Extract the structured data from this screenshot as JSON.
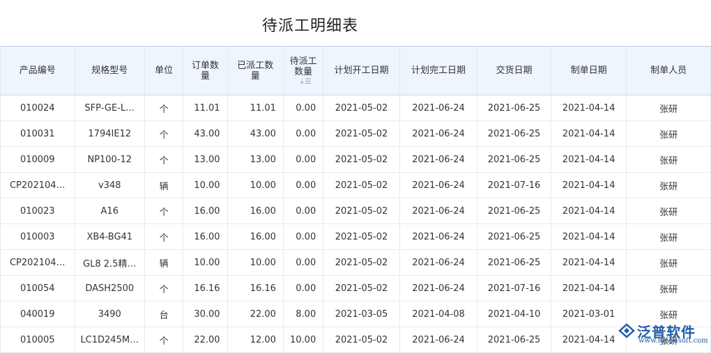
{
  "page_title": "待派工明细表",
  "columns": [
    "产品编号",
    "规格型号",
    "单位",
    "订单数量",
    "已派工数量",
    "待派工数量",
    "计划开工日期",
    "计划完工日期",
    "交货日期",
    "制单日期",
    "制单人员"
  ],
  "rows": [
    [
      "010024",
      "SFP-GE-L…",
      "个",
      "11.01",
      "11.01",
      "0.00",
      "2021-05-02",
      "2021-06-24",
      "2021-06-25",
      "2021-04-14",
      "张研"
    ],
    [
      "010031",
      "1794IE12",
      "个",
      "43.00",
      "43.00",
      "0.00",
      "2021-05-02",
      "2021-06-24",
      "2021-06-25",
      "2021-04-14",
      "张研"
    ],
    [
      "010009",
      "NP100-12",
      "个",
      "13.00",
      "13.00",
      "0.00",
      "2021-05-02",
      "2021-06-24",
      "2021-06-25",
      "2021-04-14",
      "张研"
    ],
    [
      "CP202104…",
      "v348",
      "辆",
      "10.00",
      "10.00",
      "0.00",
      "2021-05-02",
      "2021-06-24",
      "2021-07-16",
      "2021-04-14",
      "张研"
    ],
    [
      "010023",
      "A16",
      "个",
      "16.00",
      "16.00",
      "0.00",
      "2021-05-02",
      "2021-06-24",
      "2021-06-25",
      "2021-04-14",
      "张研"
    ],
    [
      "010003",
      "XB4-BG41",
      "个",
      "16.00",
      "16.00",
      "0.00",
      "2021-05-02",
      "2021-06-24",
      "2021-06-25",
      "2021-04-14",
      "张研"
    ],
    [
      "CP202104…",
      "GL8 2.5精…",
      "辆",
      "10.00",
      "10.00",
      "0.00",
      "2021-05-02",
      "2021-06-24",
      "2021-06-25",
      "2021-04-14",
      "张研"
    ],
    [
      "010054",
      "DASH2500",
      "个",
      "16.16",
      "16.16",
      "0.00",
      "2021-05-02",
      "2021-06-24",
      "2021-07-16",
      "2021-04-14",
      "张研"
    ],
    [
      "040019",
      "3490",
      "台",
      "30.00",
      "22.00",
      "8.00",
      "2021-03-05",
      "2021-04-08",
      "2021-04-10",
      "2021-03-01",
      "张研"
    ],
    [
      "010005",
      "LC1D245M…",
      "个",
      "22.00",
      "12.00",
      "10.00",
      "2021-05-02",
      "2021-06-24",
      "2021-06-25",
      "2021-04-14",
      "张研"
    ]
  ],
  "logo": {
    "name": "泛普软件",
    "url": "www.fanpusoft.com",
    "color": "#1f5da8"
  },
  "icons": {
    "sort": "sort-icon"
  }
}
